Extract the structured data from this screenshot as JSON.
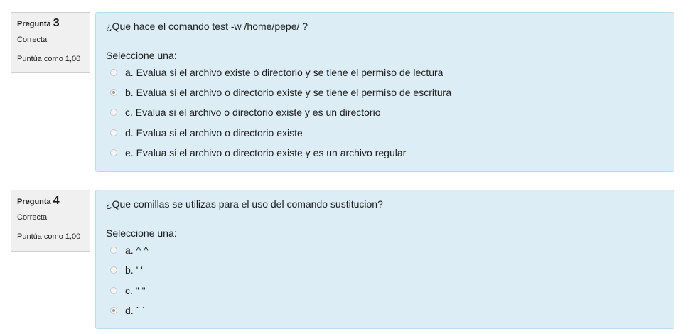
{
  "questions": [
    {
      "label": "Pregunta",
      "number": "3",
      "state": "Correcta",
      "grade": "Puntúa como 1,00",
      "text": "¿Que hace el comando test -w /home/pepe/ ?",
      "prompt": "Seleccione una:",
      "answers": [
        {
          "label": "a. Evalua si el archivo existe o directorio y se tiene el permiso de lectura",
          "checked": false
        },
        {
          "label": "b. Evalua si el archivo o directorio existe y se tiene el permiso de escritura",
          "checked": true
        },
        {
          "label": "c. Evalua si el archivo o directorio existe y es un directorio",
          "checked": false
        },
        {
          "label": "d. Evalua si el archivo o directorio existe",
          "checked": false
        },
        {
          "label": "e. Evalua si el archivo o directorio existe y es un archivo regular",
          "checked": false
        }
      ]
    },
    {
      "label": "Pregunta",
      "number": "4",
      "state": "Correcta",
      "grade": "Puntúa como 1,00",
      "text": "¿Que comillas se utilizas para el uso del comando sustitucion?",
      "prompt": "Seleccione una:",
      "answers": [
        {
          "label": "a. ^ ^",
          "checked": false
        },
        {
          "label": "b. ' '",
          "checked": false
        },
        {
          "label": "c. \" \"",
          "checked": false
        },
        {
          "label": "d. ` `",
          "checked": true
        }
      ]
    }
  ],
  "colors": {
    "info_bg": "#f0f0f0",
    "content_bg": "#dcedf6",
    "content_border": "#b9dbee"
  }
}
